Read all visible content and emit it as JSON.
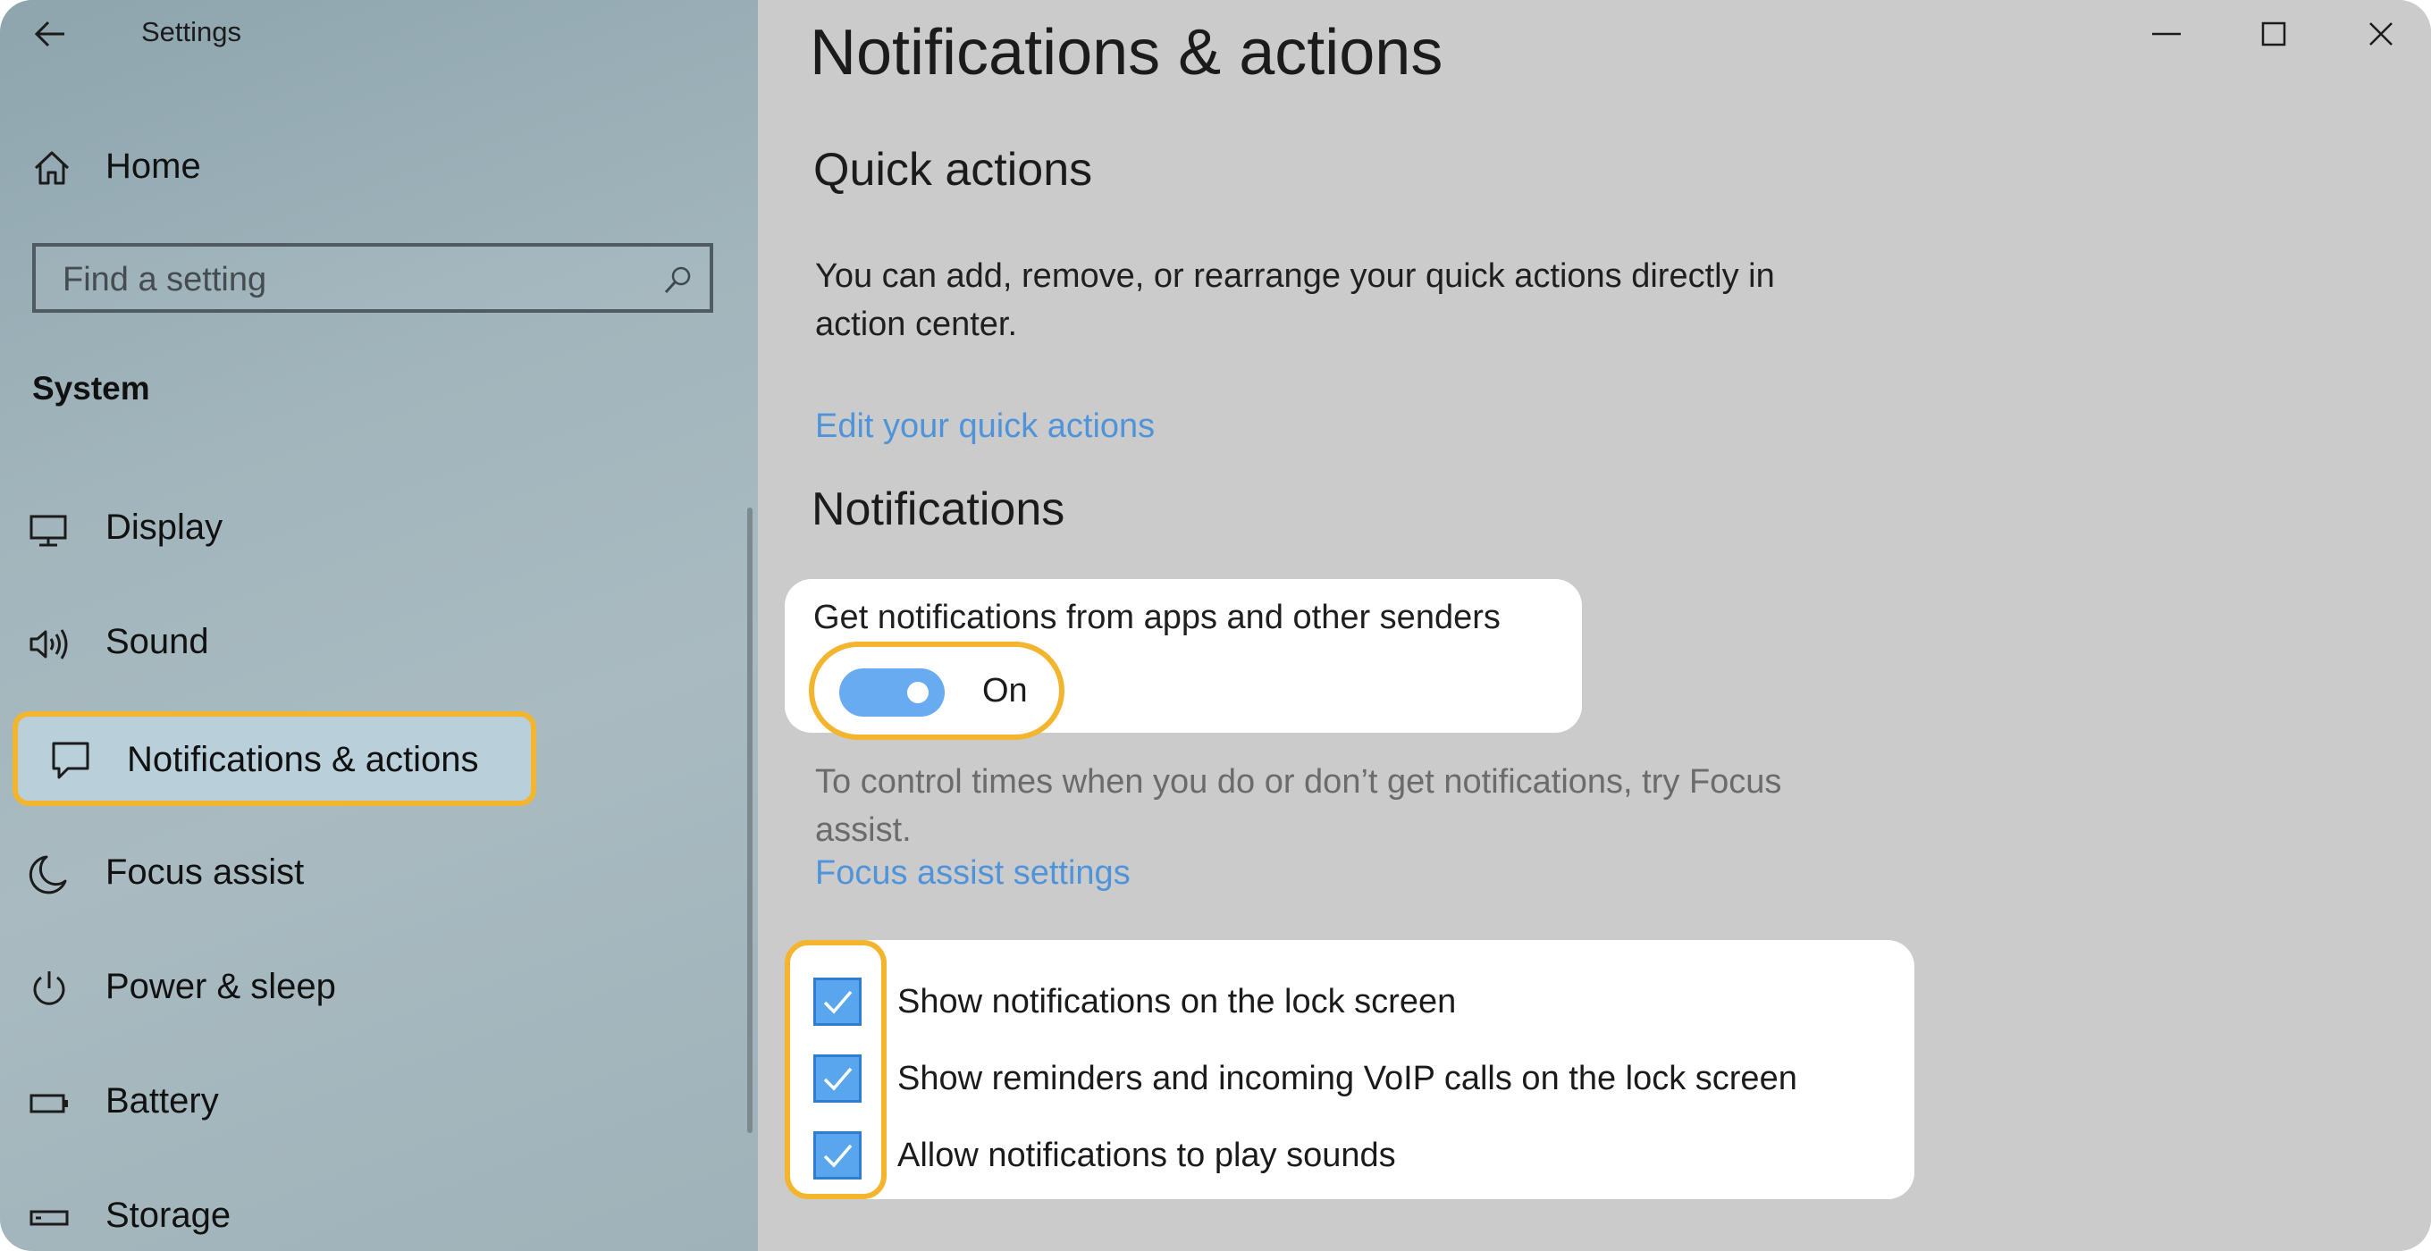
{
  "window": {
    "title": "Settings"
  },
  "sidebar": {
    "home_label": "Home",
    "search_placeholder": "Find a setting",
    "section_label": "System",
    "items": [
      {
        "label": "Display",
        "icon": "monitor-icon"
      },
      {
        "label": "Sound",
        "icon": "speaker-icon"
      },
      {
        "label": "Notifications & actions",
        "icon": "message-icon",
        "selected": true
      },
      {
        "label": "Focus assist",
        "icon": "moon-icon"
      },
      {
        "label": "Power & sleep",
        "icon": "power-icon"
      },
      {
        "label": "Battery",
        "icon": "battery-icon"
      },
      {
        "label": "Storage",
        "icon": "storage-icon"
      }
    ]
  },
  "main": {
    "page_title": "Notifications & actions",
    "quick_actions": {
      "heading": "Quick actions",
      "description": "You can add, remove, or rearrange your quick actions directly in action center.",
      "link": "Edit your quick actions"
    },
    "notifications": {
      "heading": "Notifications",
      "toggle_label": "Get notifications from apps and other senders",
      "toggle_state": "On",
      "focus_text": "To control times when you do or don’t get notifications, try Focus assist.",
      "focus_link": "Focus assist settings",
      "checkboxes": [
        {
          "label": "Show notifications on the lock screen",
          "checked": true
        },
        {
          "label": "Show reminders and incoming VoIP calls on the lock screen",
          "checked": true
        },
        {
          "label": "Allow notifications to play sounds",
          "checked": true
        }
      ]
    }
  },
  "colors": {
    "accent": "#69abf1",
    "link": "#4f94da",
    "highlight": "#f3b52e",
    "sidebar_bg": "#a2b5bc",
    "main_bg": "#cbcbcb"
  }
}
